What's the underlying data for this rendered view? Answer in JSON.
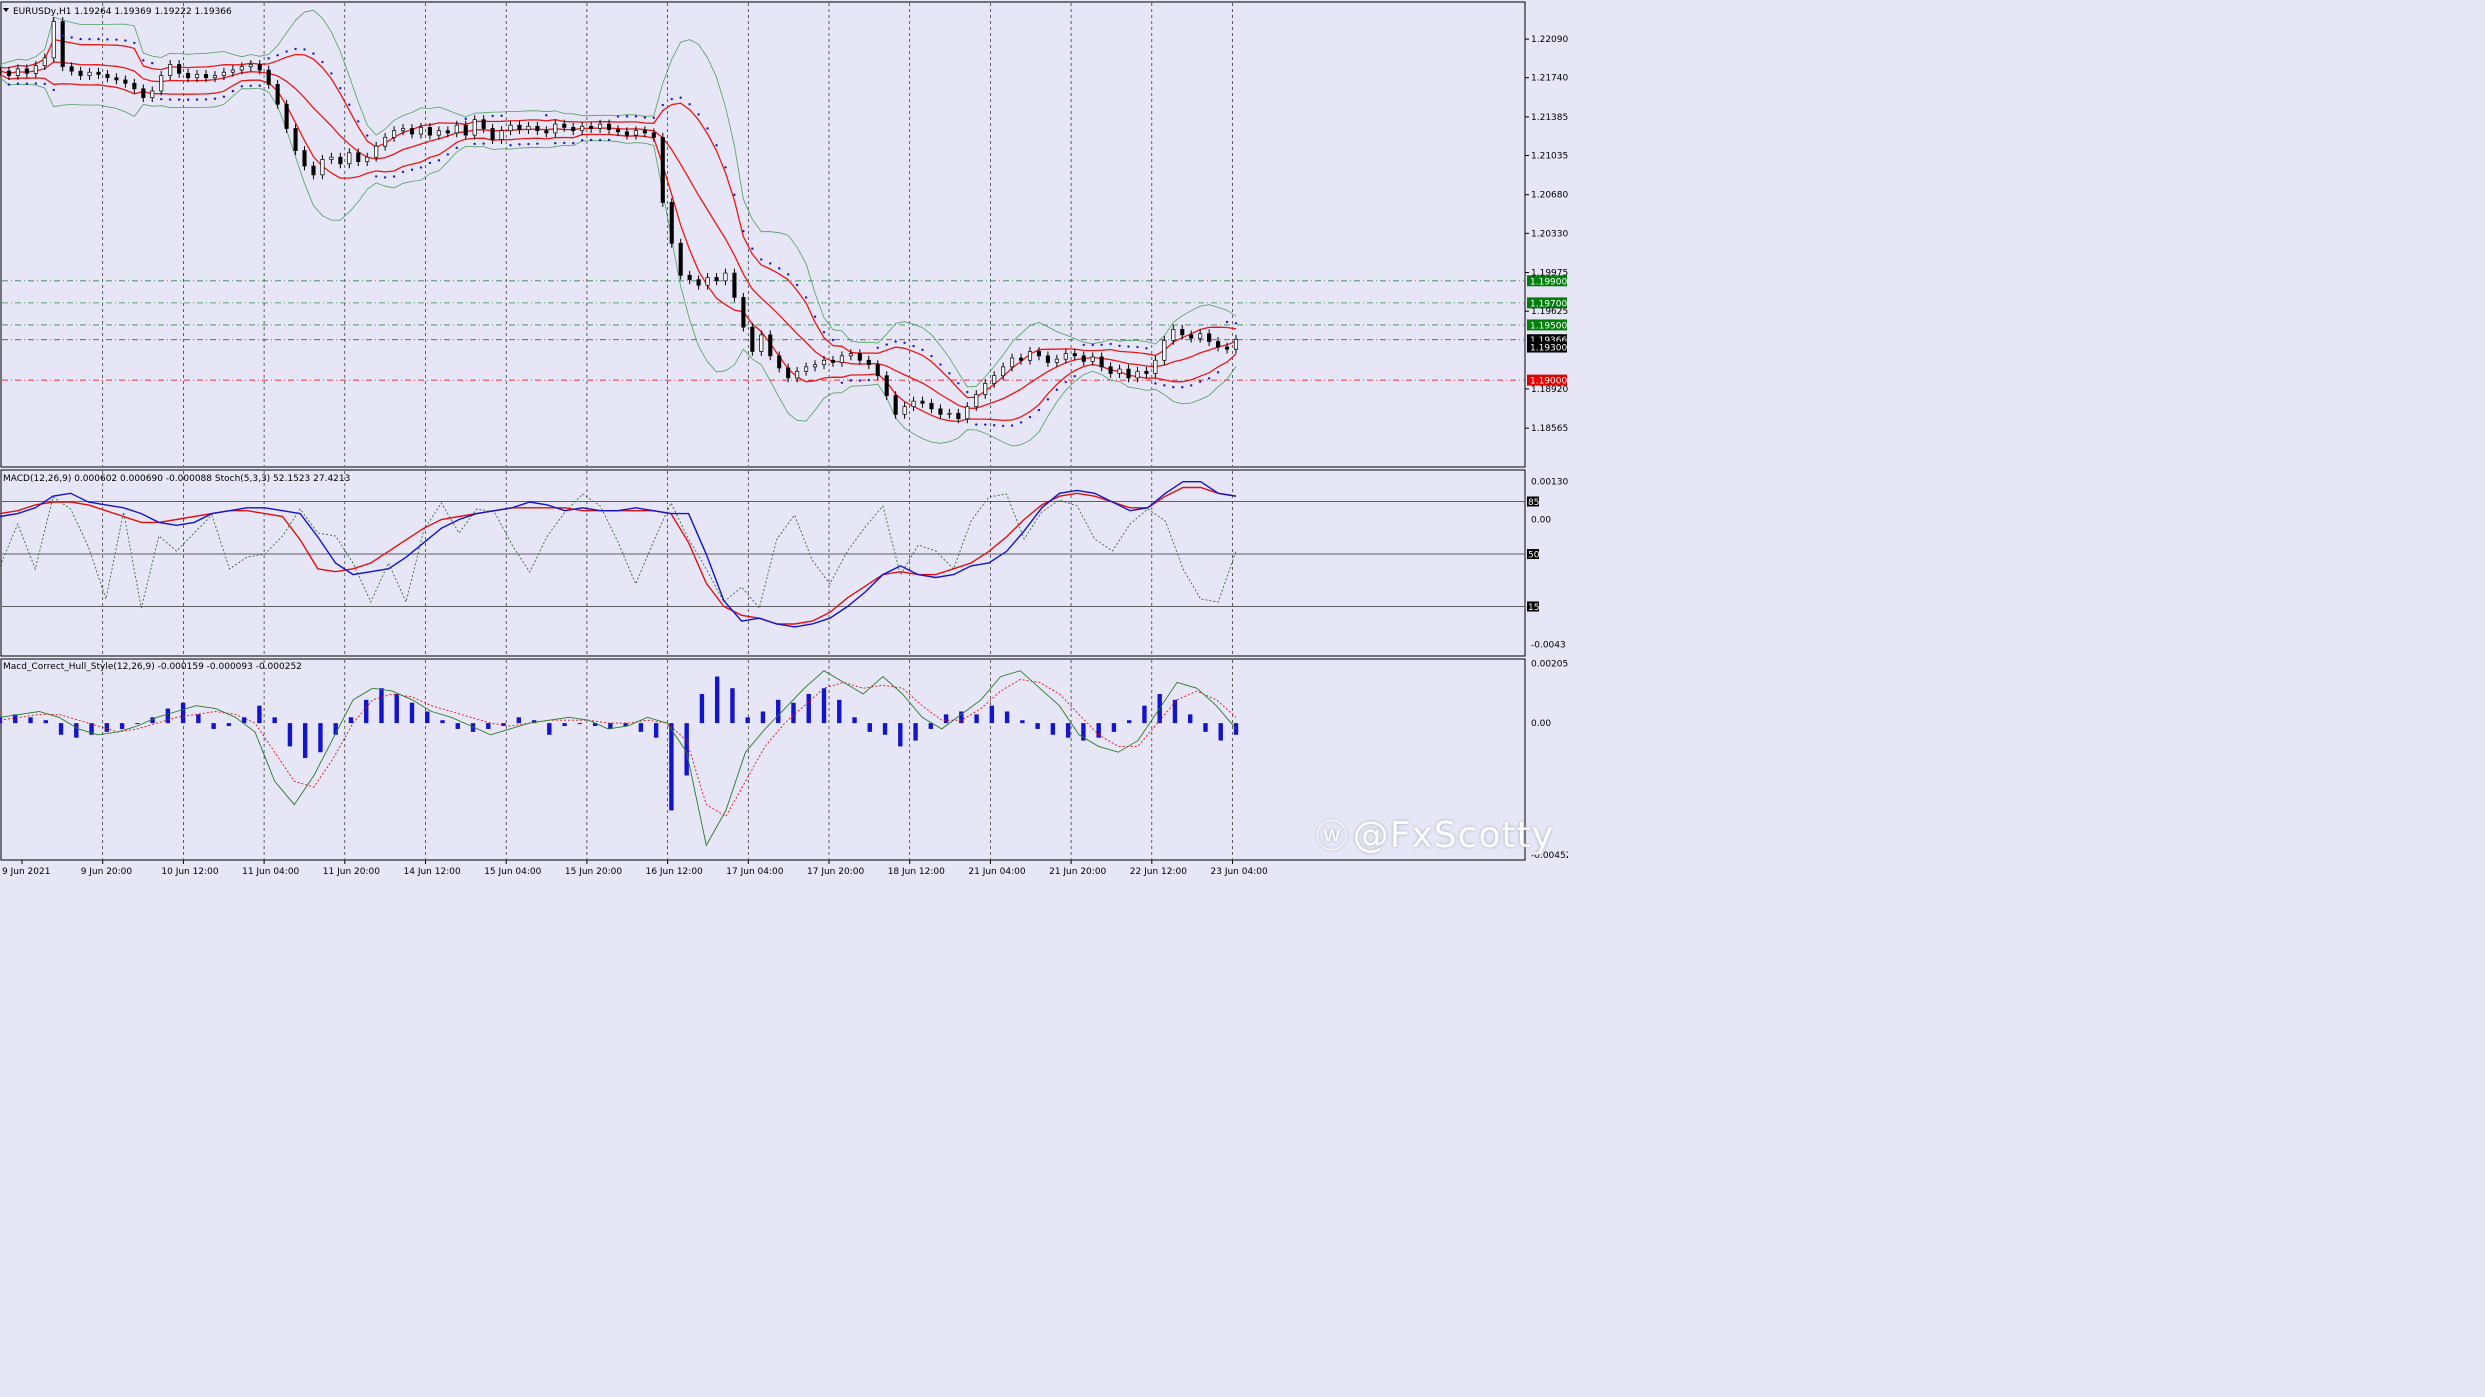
{
  "chart_data": {
    "type": "line",
    "symbol_header": "EURUSDy,H1  1.19264 1.19369 1.19222 1.19366",
    "time_labels": [
      "9 Jun 2021",
      "9 Jun 20:00",
      "10 Jun 12:00",
      "11 Jun 04:00",
      "11 Jun 20:00",
      "14 Jun 12:00",
      "15 Jun 04:00",
      "15 Jun 20:00",
      "16 Jun 12:00",
      "17 Jun 04:00",
      "17 Jun 20:00",
      "18 Jun 12:00",
      "21 Jun 04:00",
      "21 Jun 20:00",
      "22 Jun 12:00",
      "23 Jun 04:00"
    ],
    "price_axis": {
      "ticks": [
        "1.22090",
        "1.21740",
        "1.21385",
        "1.21035",
        "1.20680",
        "1.20330",
        "1.19975",
        "1.19625",
        "1.18920",
        "1.18565"
      ],
      "ylim": [
        1.1824,
        1.2239
      ]
    },
    "price_marks": [
      {
        "label": "1.19900",
        "value": 1.199,
        "color": "#00800a",
        "line_color": "#2d8a4a"
      },
      {
        "label": "1.19700",
        "value": 1.197,
        "color": "#00800a",
        "line_color": "#2d8a4a"
      },
      {
        "label": "1.19500",
        "value": 1.195,
        "color": "#00800a",
        "line_color": "#2d8a4a"
      },
      {
        "label": "1.19366",
        "value": 1.19366,
        "color": "#000000",
        "line_color": "#404040"
      },
      {
        "label": "1.19300",
        "value": 1.193,
        "color": "#000000",
        "line_color": null
      },
      {
        "label": "1.19000",
        "value": 1.19,
        "color": "#e00000",
        "line_color": "#e00000"
      }
    ],
    "close_series": [
      1.218,
      1.2176,
      1.2182,
      1.2178,
      1.2185,
      1.2192,
      1.2225,
      1.2184,
      1.218,
      1.2176,
      1.2179,
      1.2177,
      1.2174,
      1.2172,
      1.2169,
      1.2164,
      1.2156,
      1.2162,
      1.2176,
      1.2186,
      1.2178,
      1.2174,
      1.2177,
      1.2174,
      1.2176,
      1.2179,
      1.2181,
      1.2184,
      1.2186,
      1.2181,
      1.2168,
      1.215,
      1.2128,
      1.2108,
      1.2094,
      1.2086,
      1.21,
      1.2102,
      1.2096,
      1.2106,
      1.2098,
      1.2102,
      1.2112,
      1.212,
      1.2126,
      1.2128,
      1.2123,
      1.2129,
      1.2122,
      1.2126,
      1.2124,
      1.2131,
      1.2122,
      1.2136,
      1.2128,
      1.2118,
      1.2126,
      1.2131,
      1.2127,
      1.213,
      1.2126,
      1.2124,
      1.2132,
      1.2129,
      1.2126,
      1.213,
      1.2128,
      1.2132,
      1.2127,
      1.2125,
      1.2122,
      1.2126,
      1.2124,
      1.212,
      1.2061,
      1.2024,
      1.1995,
      1.1991,
      1.1986,
      1.1993,
      1.199,
      1.1997,
      1.1975,
      1.1948,
      1.1926,
      1.1941,
      1.1922,
      1.1911,
      1.1902,
      1.1908,
      1.1912,
      1.1914,
      1.1918,
      1.1916,
      1.1922,
      1.1924,
      1.1918,
      1.1914,
      1.1904,
      1.1886,
      1.1869,
      1.1876,
      1.1881,
      1.1879,
      1.1874,
      1.1869,
      1.187,
      1.1865,
      1.1876,
      1.1887,
      1.1897,
      1.1904,
      1.1912,
      1.192,
      1.1918,
      1.1926,
      1.1922,
      1.1916,
      1.1919,
      1.1924,
      1.1922,
      1.1917,
      1.1921,
      1.1912,
      1.1906,
      1.191,
      1.1902,
      1.1908,
      1.1906,
      1.1918,
      1.1936,
      1.1946,
      1.1941,
      1.1938,
      1.1942,
      1.1935,
      1.193,
      1.1928,
      1.1937
    ],
    "macd_panel": {
      "header": "MACD(12,26,9) 0.000602 0.000690 -0.000088  Stoch(5,3,3) 52.1523 27.4213",
      "ticks": [
        "0.001304",
        "0.00",
        "-0.0043"
      ],
      "levels": [
        "85",
        "50",
        "15"
      ],
      "ylim": [
        -0.0046,
        0.0016
      ],
      "macd_series": [
        0.0001,
        0.0002,
        0.0004,
        0.0008,
        0.0009,
        0.0006,
        0.0005,
        0.0004,
        0.0002,
        -0.0001,
        -0.0002,
        -0.0001,
        0.0002,
        0.0003,
        0.0004,
        0.0004,
        0.0003,
        0.0002,
        -0.0006,
        -0.0015,
        -0.0019,
        -0.0018,
        -0.0017,
        -0.0013,
        -0.0008,
        -0.0003,
        0.0,
        0.0002,
        0.0003,
        0.0004,
        0.0006,
        0.0005,
        0.0003,
        0.0004,
        0.0003,
        0.0003,
        0.0004,
        0.0003,
        0.0002,
        0.0002,
        -0.0012,
        -0.0028,
        -0.0035,
        -0.0034,
        -0.0036,
        -0.0037,
        -0.0036,
        -0.0034,
        -0.003,
        -0.0025,
        -0.0019,
        -0.0016,
        -0.0019,
        -0.002,
        -0.0019,
        -0.0016,
        -0.0015,
        -0.0011,
        -0.0004,
        0.0004,
        0.0009,
        0.001,
        0.0009,
        0.0006,
        0.0003,
        0.0004,
        0.0009,
        0.0013,
        0.0013,
        0.0009,
        0.0008
      ],
      "signal_series": [
        0.0002,
        0.0003,
        0.0005,
        0.0006,
        0.0006,
        0.0005,
        0.0003,
        0.0001,
        -0.0001,
        -0.0001,
        0.0,
        0.0001,
        0.0002,
        0.0003,
        0.0003,
        0.0002,
        0.0001,
        -0.0007,
        -0.0017,
        -0.0018,
        -0.0017,
        -0.0015,
        -0.0011,
        -0.0007,
        -0.0003,
        0.0,
        0.0001,
        0.0002,
        0.0003,
        0.0004,
        0.0004,
        0.0004,
        0.0004,
        0.0003,
        0.0003,
        0.0003,
        0.0003,
        0.0003,
        0.0002,
        -0.0008,
        -0.0022,
        -0.003,
        -0.0033,
        -0.0034,
        -0.0036,
        -0.0036,
        -0.0035,
        -0.0032,
        -0.0027,
        -0.0023,
        -0.0019,
        -0.0018,
        -0.0019,
        -0.0019,
        -0.0017,
        -0.0015,
        -0.0011,
        -0.0006,
        0.0,
        0.0005,
        0.0008,
        0.0009,
        0.0008,
        0.0006,
        0.0004,
        0.0004,
        0.0008,
        0.0011,
        0.0011,
        0.0009,
        0.0008
      ],
      "stoch_series": [
        42,
        70,
        40,
        88,
        80,
        55,
        20,
        78,
        14,
        62,
        52,
        64,
        76,
        40,
        48,
        50,
        62,
        80,
        64,
        62,
        44,
        18,
        44,
        18,
        66,
        84,
        64,
        80,
        78,
        56,
        38,
        62,
        78,
        90,
        82,
        58,
        30,
        58,
        84,
        60,
        40,
        18,
        28,
        14,
        60,
        76,
        46,
        30,
        52,
        68,
        82,
        36,
        56,
        52,
        40,
        72,
        88,
        90,
        60,
        78,
        86,
        82,
        60,
        52,
        70,
        80,
        72,
        40,
        20,
        18,
        52
      ]
    },
    "hull_panel": {
      "header": "Macd_Correct_Hull_Style(12,26,9) -0.000159 -0.000093 -0.000252",
      "ticks": [
        "0.002053",
        "0.00",
        "-0.004523"
      ],
      "ylim": [
        -0.0046,
        0.0021
      ],
      "histogram": [
        0.0002,
        0.0003,
        0.0002,
        0.0001,
        -0.0004,
        -0.0005,
        -0.0004,
        -0.0003,
        -0.0002,
        0.0,
        0.0002,
        0.0005,
        0.0007,
        0.0003,
        -0.0002,
        -0.0001,
        0.0002,
        0.0006,
        0.0002,
        -0.0008,
        -0.0012,
        -0.001,
        -0.0004,
        0.0002,
        0.0008,
        0.0012,
        0.001,
        0.0007,
        0.0004,
        0.0001,
        -0.0002,
        -0.0003,
        -0.0002,
        -0.0001,
        0.0002,
        0.0001,
        -0.0004,
        -0.0001,
        0.0,
        -0.0001,
        -0.0002,
        -0.0001,
        -0.0003,
        -0.0005,
        -0.003,
        -0.0018,
        0.001,
        0.0016,
        0.0012,
        0.0002,
        0.0004,
        0.0008,
        0.0007,
        0.001,
        0.0012,
        0.0008,
        0.0002,
        -0.0003,
        -0.0004,
        -0.0008,
        -0.0006,
        -0.0002,
        0.0003,
        0.0004,
        0.0003,
        0.0006,
        0.0004,
        0.0001,
        -0.0002,
        -0.0004,
        -0.0005,
        -0.0006,
        -0.0005,
        -0.0003,
        0.0001,
        0.0006,
        0.001,
        0.0008,
        0.0003,
        -0.0003,
        -0.0006,
        -0.0004
      ],
      "fast_series": [
        0.0002,
        0.0003,
        0.0004,
        0.0002,
        -0.0002,
        -0.0004,
        -0.0003,
        -0.0001,
        0.0002,
        0.0004,
        0.0006,
        0.0005,
        0.0002,
        -0.0003,
        -0.002,
        -0.0028,
        -0.0018,
        -0.0005,
        0.0008,
        0.0012,
        0.0011,
        0.0008,
        0.0004,
        0.0002,
        -0.0001,
        -0.0004,
        -0.0002,
        0.0,
        0.0001,
        0.0002,
        0.0001,
        -0.0002,
        -0.0001,
        0.0002,
        0.0,
        -0.001,
        -0.0042,
        -0.003,
        -0.001,
        -0.0002,
        0.0005,
        0.0012,
        0.0018,
        0.0014,
        0.001,
        0.0016,
        0.001,
        0.0002,
        -0.0002,
        0.0003,
        0.0008,
        0.0016,
        0.0018,
        0.0012,
        0.0006,
        -0.0004,
        -0.0008,
        -0.001,
        -0.0006,
        0.0004,
        0.0014,
        0.0012,
        0.0006,
        -0.0002
      ],
      "slow_series": [
        0.0001,
        0.0002,
        0.0003,
        0.0003,
        0.0001,
        -0.0001,
        -0.0003,
        -0.0002,
        0.0,
        0.0002,
        0.0003,
        0.0004,
        0.0003,
        0.0,
        -0.001,
        -0.002,
        -0.0022,
        -0.0012,
        0.0,
        0.0008,
        0.001,
        0.0009,
        0.0006,
        0.0004,
        0.0002,
        0.0,
        -0.0001,
        0.0,
        0.0001,
        0.0001,
        0.0001,
        0.0,
        0.0,
        0.0001,
        0.0,
        -0.0006,
        -0.0028,
        -0.0032,
        -0.002,
        -0.0008,
        0.0,
        0.0006,
        0.0012,
        0.0014,
        0.0012,
        0.0013,
        0.0012,
        0.0006,
        0.0001,
        0.0001,
        0.0005,
        0.0011,
        0.0015,
        0.0014,
        0.001,
        0.0003,
        -0.0004,
        -0.0008,
        -0.0008,
        0.0,
        0.0008,
        0.0011,
        0.0008,
        0.0002
      ]
    }
  },
  "watermark": {
    "icon": "weibo-icon",
    "text": "@FxScotty"
  },
  "colors": {
    "background": "#e6e6f6",
    "candle_bull_fill": "#ffffff",
    "candle_bear_fill": "#000000",
    "bands_red": "#e81818",
    "bollinger": "#4fa060",
    "sar": "#1818d0",
    "macd": "#1414c8",
    "signal": "#e01010",
    "stoch": "#3a6a3a"
  }
}
